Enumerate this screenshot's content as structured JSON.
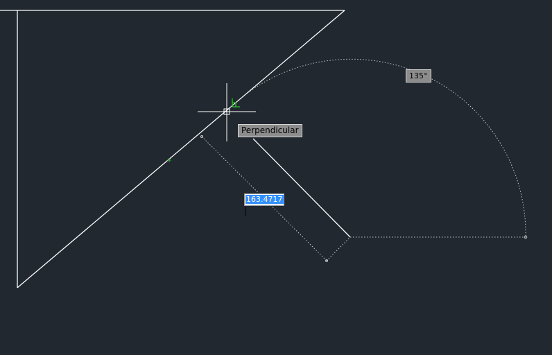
{
  "snap_tooltip": {
    "label": "Perpendicular"
  },
  "angle_tooltip": {
    "label": "135°"
  },
  "distance_input": {
    "value": "163.4717"
  },
  "colors": {
    "background": "#212830",
    "geometry": "#ffffff",
    "dimension": "#c8c8c8",
    "snap_marker": "#2fbf2f",
    "selection": "#3390ff"
  },
  "icons": {
    "crosshair": "crosshair-cursor-icon",
    "snap": "perpendicular-snap-icon",
    "midpoint": "midpoint-marker-icon"
  }
}
